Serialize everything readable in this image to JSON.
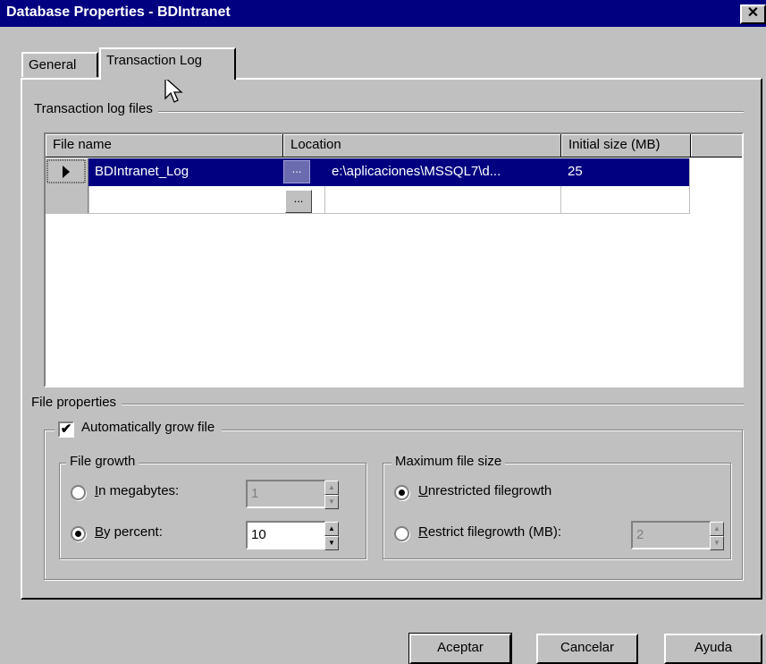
{
  "window": {
    "title": "Database Properties - BDIntranet",
    "close_glyph": "✕"
  },
  "tabs": [
    {
      "label": "General",
      "selected": false
    },
    {
      "label": "Transaction Log",
      "selected": true
    }
  ],
  "log_files": {
    "section_label": "Transaction log files",
    "columns": [
      "File name",
      "Location",
      "Initial size (MB)"
    ],
    "rows": [
      {
        "file_name": "BDIntranet_Log",
        "location": "e:\\aplicaciones\\MSSQL7\\d...",
        "initial_size": "25",
        "selected": true
      },
      {
        "file_name": "",
        "location": "",
        "initial_size": "",
        "selected": false
      }
    ],
    "ellipsis": "..."
  },
  "file_properties": {
    "section_label": "File properties",
    "auto_grow_label": "Automatically grow file",
    "auto_grow_checked": true,
    "check_glyph": "✔",
    "file_growth": {
      "title": "File growth",
      "in_megabytes_label": "In megabytes:",
      "in_megabytes_value": "1",
      "by_percent_label": "By percent:",
      "by_percent_value": "10",
      "selected": "by_percent"
    },
    "max_size": {
      "title": "Maximum file size",
      "unrestricted_label": "Unrestricted filegrowth",
      "restrict_label": "Restrict filegrowth (MB):",
      "restrict_value": "2",
      "selected": "unrestricted"
    }
  },
  "buttons": {
    "ok": "Aceptar",
    "cancel": "Cancelar",
    "help": "Ayuda"
  },
  "icons": {
    "row_pointer": "row-pointer-icon",
    "spin_up": "▲",
    "spin_down": "▼"
  }
}
